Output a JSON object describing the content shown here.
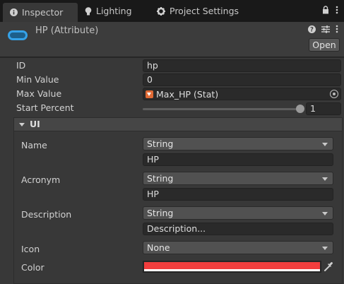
{
  "tabs": [
    {
      "label": "Inspector",
      "icon": "info-icon",
      "active": true
    },
    {
      "label": "Lighting",
      "icon": "lightbulb-icon",
      "active": false
    },
    {
      "label": "Project Settings",
      "icon": "gear-icon",
      "active": false
    }
  ],
  "header": {
    "title": "HP (Attribute)",
    "open_label": "Open",
    "tool_icons": [
      "help-icon",
      "presets-icon",
      "more-icon"
    ]
  },
  "properties": {
    "id": {
      "label": "ID",
      "value": "hp"
    },
    "min_value": {
      "label": "Min Value",
      "value": "0"
    },
    "max_value": {
      "label": "Max Value",
      "value": "Max_HP (Stat)"
    },
    "start_percent": {
      "label": "Start Percent",
      "value": "1",
      "fraction": 1
    }
  },
  "ui": {
    "title": "UI",
    "name": {
      "label": "Name",
      "type": "String",
      "value": "HP"
    },
    "acronym": {
      "label": "Acronym",
      "type": "String",
      "value": "HP"
    },
    "description": {
      "label": "Description",
      "type": "String",
      "placeholder": "Description..."
    },
    "icon": {
      "label": "Icon",
      "value": "None"
    },
    "color": {
      "label": "Color",
      "hex": "#f23d3d"
    }
  },
  "colors": {
    "accent_blue": "#35a2e8",
    "stat_orange": "#e06a35"
  }
}
